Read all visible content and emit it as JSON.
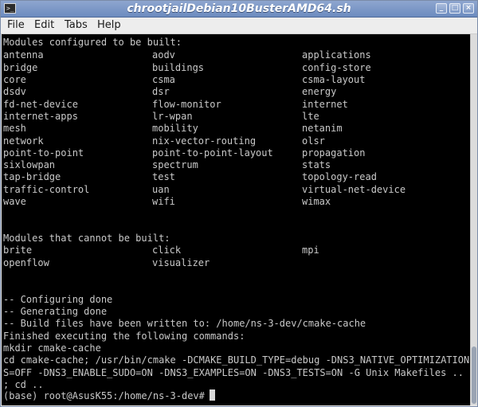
{
  "window": {
    "title": "chrootjailDebian10BusterAMD64.sh",
    "app_icon_text": ">_",
    "controls": {
      "minimize": "_",
      "maximize": "□",
      "close": "×"
    }
  },
  "menu": {
    "file": "File",
    "edit": "Edit",
    "tabs": "Tabs",
    "help": "Help"
  },
  "terminal": {
    "configured_header": "Modules configured to be built:",
    "configured_rows": [
      [
        "antenna",
        "aodv",
        "applications"
      ],
      [
        "bridge",
        "buildings",
        "config-store"
      ],
      [
        "core",
        "csma",
        "csma-layout"
      ],
      [
        "dsdv",
        "dsr",
        "energy"
      ],
      [
        "fd-net-device",
        "flow-monitor",
        "internet"
      ],
      [
        "internet-apps",
        "lr-wpan",
        "lte"
      ],
      [
        "mesh",
        "mobility",
        "netanim"
      ],
      [
        "network",
        "nix-vector-routing",
        "olsr"
      ],
      [
        "point-to-point",
        "point-to-point-layout",
        "propagation"
      ],
      [
        "sixlowpan",
        "spectrum",
        "stats"
      ],
      [
        "tap-bridge",
        "test",
        "topology-read"
      ],
      [
        "traffic-control",
        "uan",
        "virtual-net-device"
      ],
      [
        "wave",
        "wifi",
        "wimax"
      ]
    ],
    "not_built_header": "Modules that cannot be built:",
    "not_built_rows": [
      [
        "brite",
        "click",
        "mpi"
      ],
      [
        "openflow",
        "visualizer",
        ""
      ]
    ],
    "log_lines": [
      "-- Configuring done",
      "-- Generating done",
      "-- Build files have been written to: /home/ns-3-dev/cmake-cache",
      "Finished executing the following commands:",
      "mkdir cmake-cache",
      "cd cmake-cache; /usr/bin/cmake -DCMAKE_BUILD_TYPE=debug -DNS3_NATIVE_OPTIMIZATION",
      "S=OFF -DNS3_ENABLE_SUDO=ON -DNS3_EXAMPLES=ON -DNS3_TESTS=ON -G Unix Makefiles ..",
      "; cd .."
    ],
    "prompt": "(base) root@AsusK55:/home/ns-3-dev# "
  }
}
